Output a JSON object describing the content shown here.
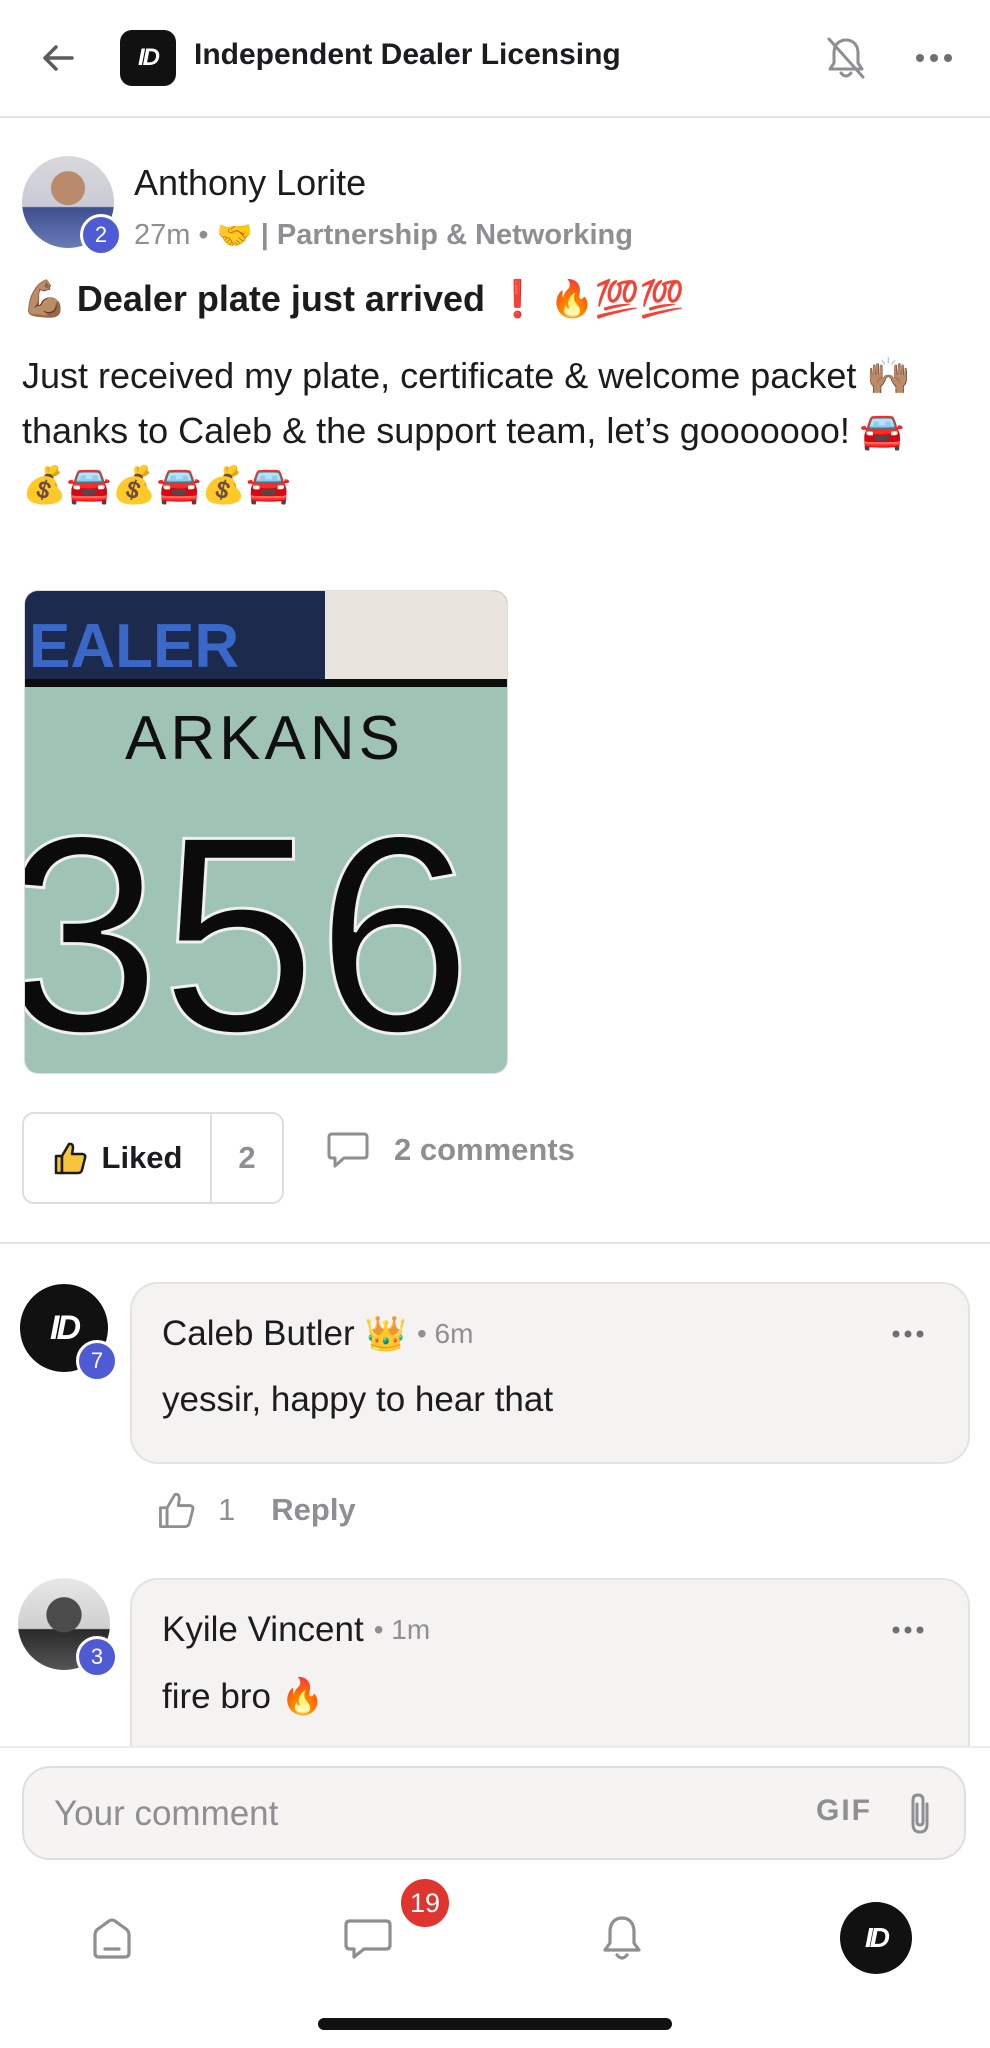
{
  "header": {
    "title": "Independent Dealer Licensing",
    "logo_text": "ID",
    "icons": [
      "back-arrow-icon",
      "bell-off-icon",
      "more-horizontal-icon"
    ]
  },
  "post": {
    "author": "Anthony Lorite",
    "author_level": "2",
    "time": "27m",
    "separator": "•",
    "category_emoji": "🤝",
    "category": "| Partnership & Networking",
    "title": "💪🏽 Dealer plate just arrived ❗️ 🔥💯💯",
    "body_line1": "Just received my plate, certificate & welcome packet 🙌🏽",
    "body_line2": "thanks to Caleb & the support team, let’s gooooooo! 🚘",
    "body_line3": "💰🚘💰🚘💰🚘",
    "image_text_top": "EALER",
    "image_text_state": "ARKANS",
    "image_text_number": "356",
    "liked_label": "Liked",
    "like_count": "2",
    "comments_label": "2 comments"
  },
  "comments": [
    {
      "author": "Caleb Butler",
      "author_emoji": "👑",
      "time": "• 6m",
      "text": "yessir, happy to hear that",
      "avatar_text": "ID",
      "level": "7",
      "like_count": "1",
      "reply_label": "Reply"
    },
    {
      "author": "Kyile Vincent",
      "time": "• 1m",
      "text": "fire bro 🔥",
      "level": "3"
    }
  ],
  "composer": {
    "placeholder": "Your comment",
    "gif_label": "GIF"
  },
  "tabbar": {
    "messages_badge": "19",
    "profile_text": "ID"
  },
  "colors": {
    "level_badge": "#4f5bd5",
    "notification_badge": "#e0342f",
    "muted_text": "#8e8e93"
  }
}
